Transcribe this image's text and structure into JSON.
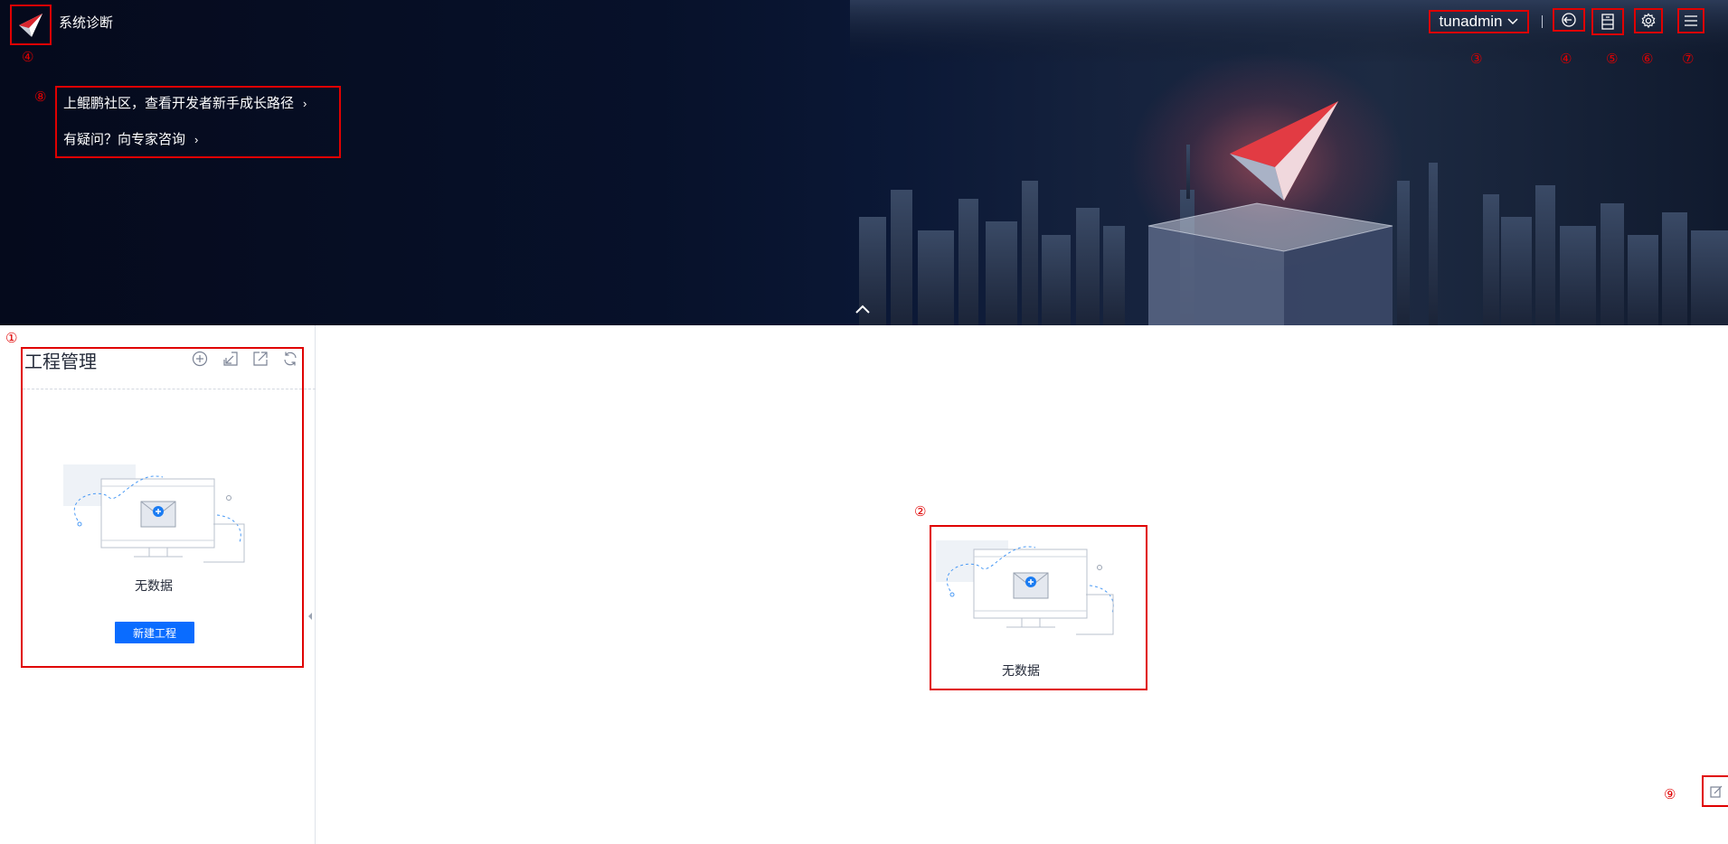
{
  "header": {
    "app_title": "系统诊断",
    "username": "tunadmin",
    "links": [
      {
        "label": "上鲲鹏社区，查看开发者新手成长路径"
      },
      {
        "label": "有疑问？向专家咨询"
      }
    ],
    "icons": {
      "logo": "kunpeng-logo-icon",
      "logout": "logout-icon",
      "server": "server-icon",
      "settings": "gear-icon",
      "menu": "menu-icon",
      "collapse": "chevron-up-icon"
    }
  },
  "annotations": {
    "logo": "④",
    "links": "⑧",
    "user": "③",
    "logout": "④",
    "server": "⑤",
    "settings": "⑥",
    "menu": "⑦",
    "left_panel": "①",
    "center": "②",
    "feedback": "⑨"
  },
  "left_panel": {
    "title": "工程管理",
    "toolbar": [
      "add-circle-icon",
      "import-icon",
      "export-icon",
      "refresh-icon"
    ],
    "empty_text": "无数据",
    "new_button": "新建工程"
  },
  "main": {
    "empty_text": "无数据"
  },
  "colors": {
    "annotation": "#e00000",
    "primary": "#0a6cff",
    "banner_dark": "#050a1c"
  }
}
